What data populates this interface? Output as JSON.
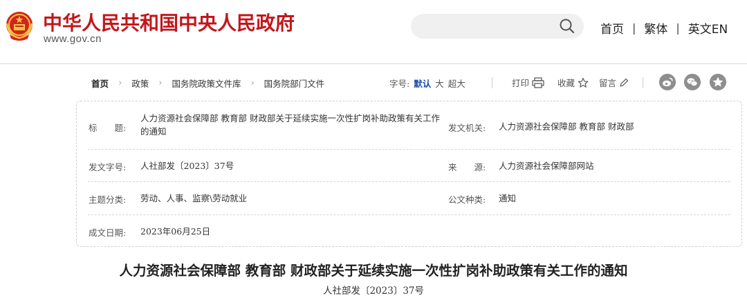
{
  "header": {
    "site_title": "中华人民共和国中央人民政府",
    "site_url": "www.gov.cn",
    "search_placeholder": "",
    "nav": [
      "首页",
      "繁体",
      "英文EN"
    ],
    "brand_color": "#c3161c"
  },
  "breadcrumb": {
    "items": [
      "首页",
      "政策",
      "国务院政策文件库",
      "国务院部门文件"
    ]
  },
  "font_size": {
    "label": "字号:",
    "options": [
      "默认",
      "大",
      "超大"
    ],
    "active": "默认"
  },
  "tools": {
    "print": "打印",
    "favorite": "收藏",
    "comment": "留言"
  },
  "share": {
    "icons": [
      "weibo-icon",
      "wechat-icon",
      "qzone-icon"
    ]
  },
  "info": {
    "title_label": "标　　题:",
    "title_value": "人力资源社会保障部 教育部 财政部关于延续实施一次性扩岗补助政策有关工作的通知",
    "issuer_label": "发文机关:",
    "issuer_value": "人力资源社会保障部 教育部 财政部",
    "doc_no_label": "发文字号:",
    "doc_no_value": "人社部发〔2023〕37号",
    "source_label": "来　　源:",
    "source_value": "人力资源社会保障部网站",
    "topic_label": "主题分类:",
    "topic_value": "劳动、人事、监察\\劳动就业",
    "doc_type_label": "公文种类:",
    "doc_type_value": "通知",
    "date_label": "成文日期:",
    "date_value": "2023年06月25日"
  },
  "document": {
    "title": "人力资源社会保障部 教育部 财政部关于延续实施一次性扩岗补助政策有关工作的通知",
    "number": "人社部发〔2023〕37号"
  }
}
